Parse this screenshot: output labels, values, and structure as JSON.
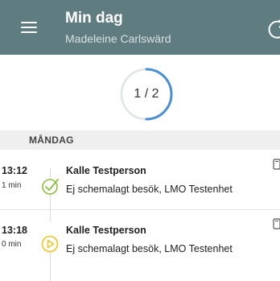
{
  "appbar": {
    "title": "Min dag",
    "subtitle": "Madeleine Carlswärd",
    "background": "#5f7d80"
  },
  "progress": {
    "label": "1 / 2",
    "completed": 1,
    "total": 2,
    "ring_color": "#4a8fd6",
    "track_color": "#e4e7ea"
  },
  "day": {
    "label": "MÅNDAG"
  },
  "visits": [
    {
      "time": "13:12",
      "duration": "1 min",
      "status_icon": "check-circle-icon",
      "status_color": "#8fbf3f",
      "person": "Kalle Testperson",
      "description": "Ej schemalagt besök, LMO Testenhet"
    },
    {
      "time": "13:18",
      "duration": "0 min",
      "status_icon": "play-circle-icon",
      "status_color": "#f2c21b",
      "person": "Kalle Testperson",
      "description": "Ej schemalagt besök, LMO Testenhet"
    }
  ]
}
